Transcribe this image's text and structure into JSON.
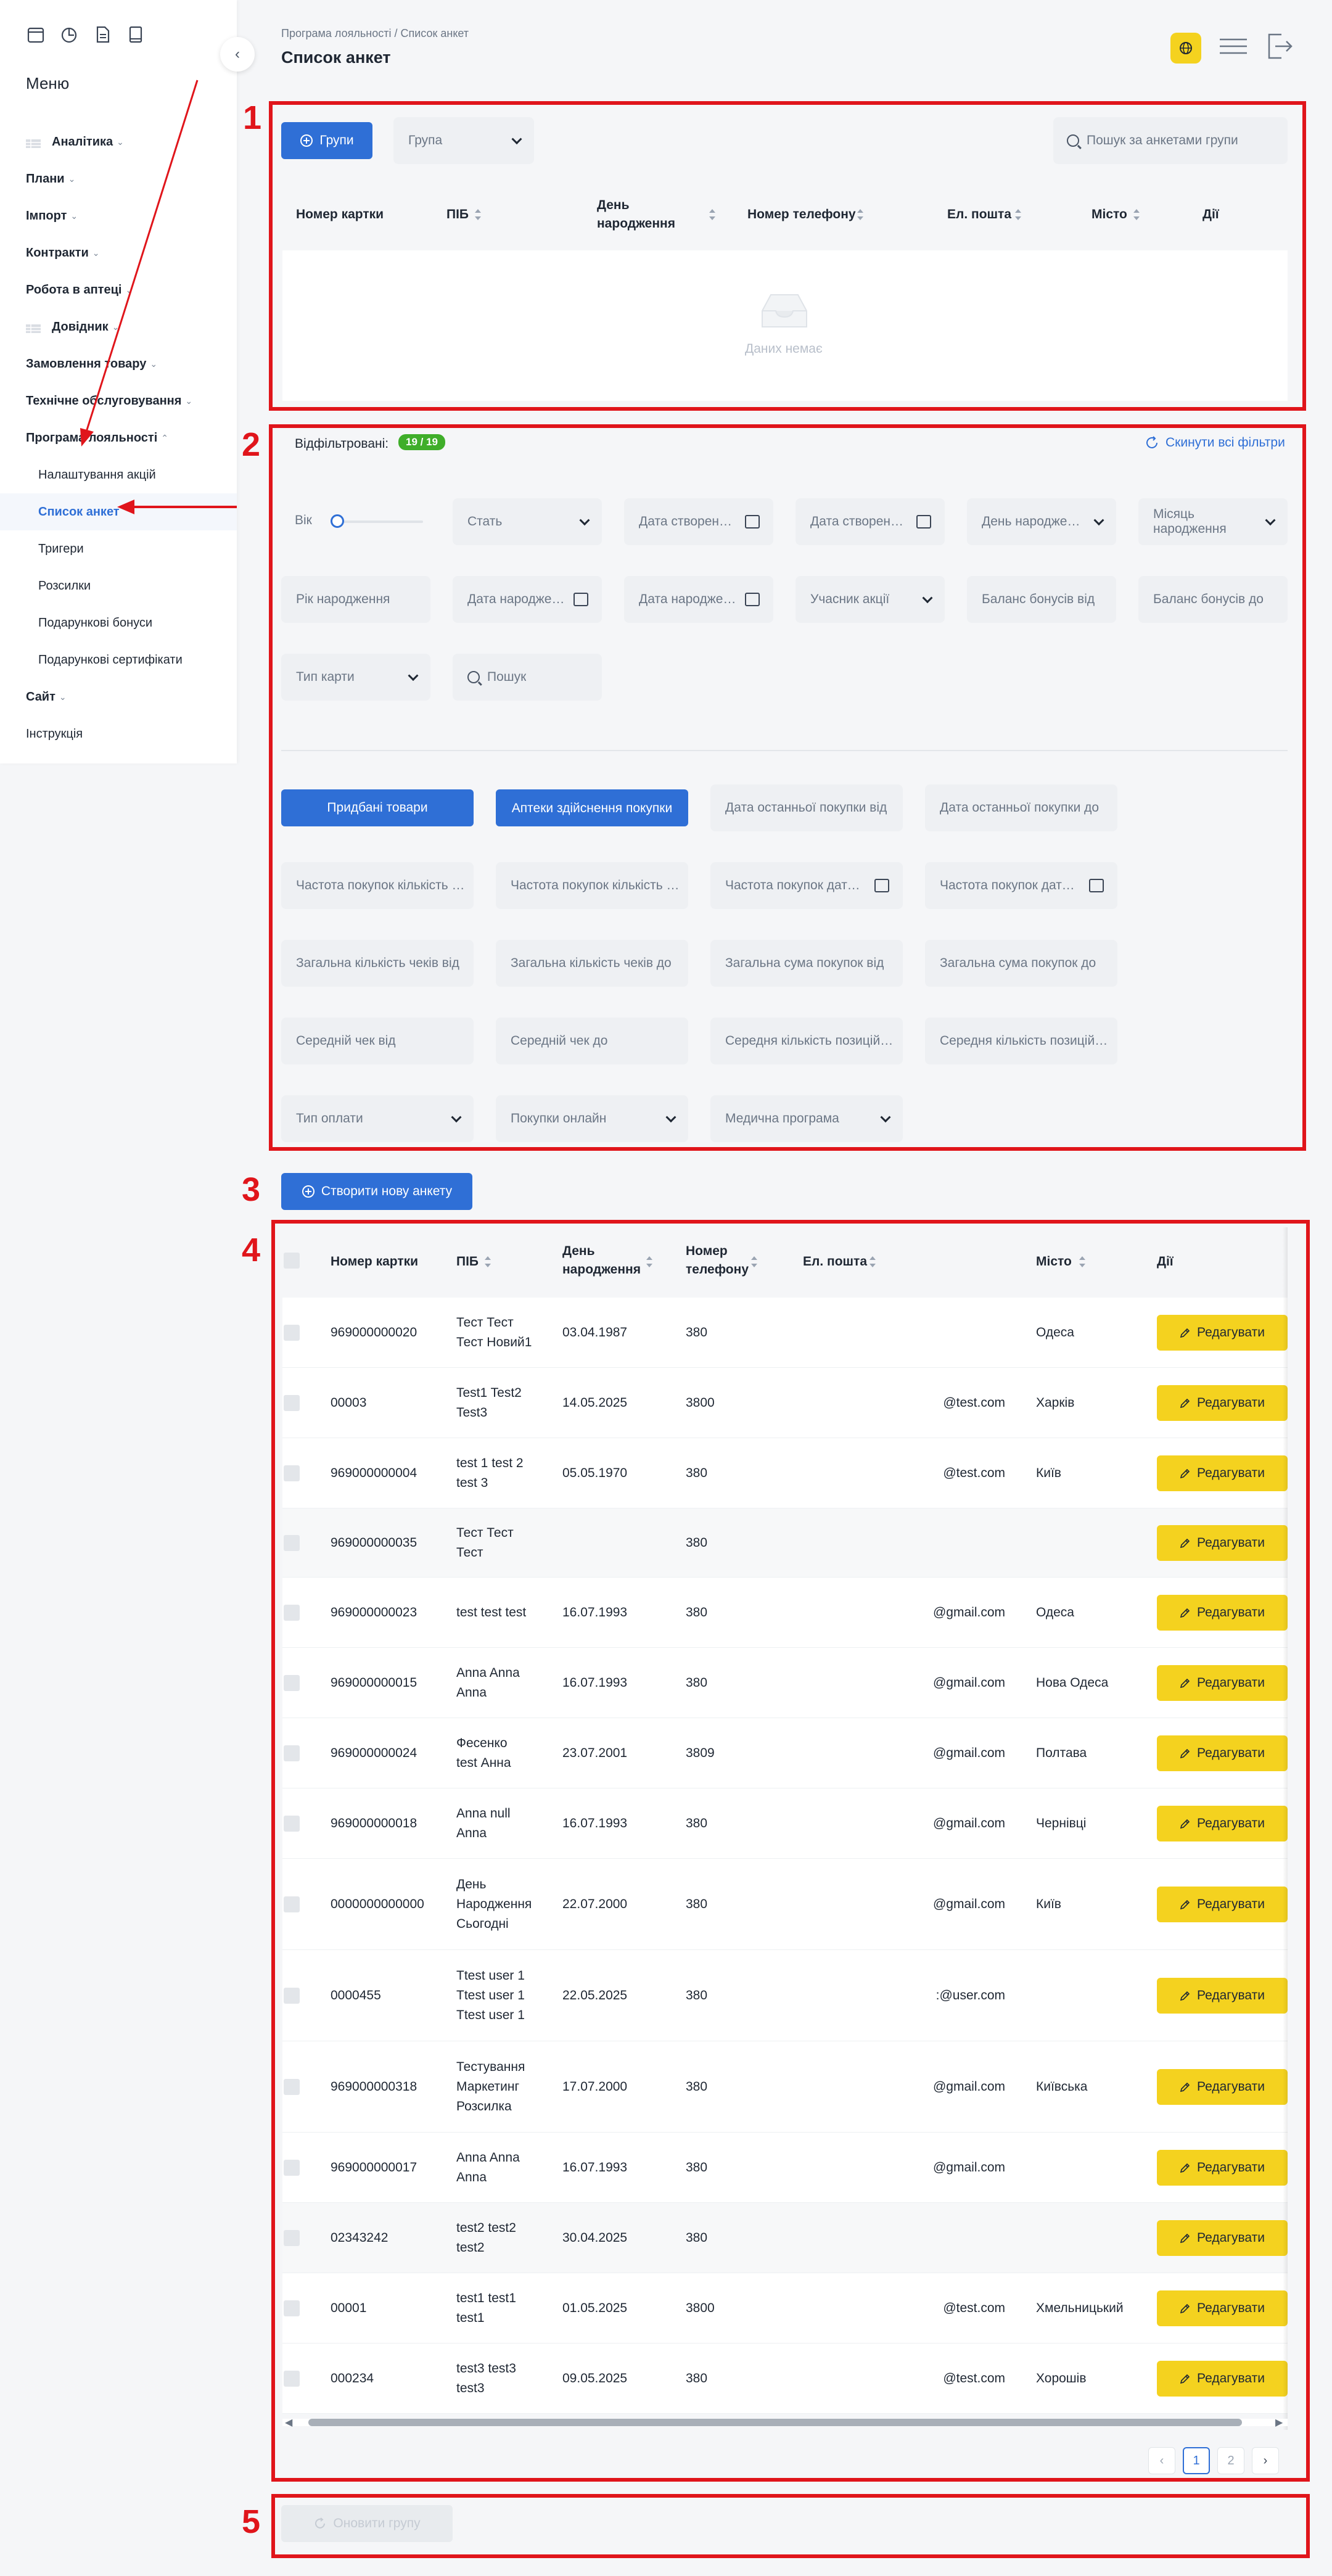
{
  "sidebar": {
    "menu_title": "Меню",
    "items": [
      {
        "label": "Аналітика",
        "chev": "⌄",
        "icon": "table-icon"
      },
      {
        "label": "Плани",
        "chev": "⌄"
      },
      {
        "label": "Імпорт",
        "chev": "⌄"
      },
      {
        "label": "Контракти",
        "chev": "⌄"
      },
      {
        "label": "Робота в аптеці",
        "chev": "⌄"
      },
      {
        "label": "Довідник",
        "chev": "⌄",
        "icon": "table-icon"
      },
      {
        "label": "Замовлення товару",
        "chev": "⌄"
      },
      {
        "label": "Технічне обслуговування",
        "chev": "⌄"
      },
      {
        "label": "Програма лояльності",
        "chev": "⌃"
      }
    ],
    "sub_items": [
      "Налаштування акцій",
      "Список анкет",
      "Тригери",
      "Розсилки",
      "Подарункові бонуси",
      "Подарункові сертифікати"
    ],
    "bottom_items": [
      "Сайт",
      "Інструкція"
    ],
    "bottom_chev": "⌄"
  },
  "header": {
    "breadcrumb": "Програма лояльності / Список анкет",
    "title": "Список анкет"
  },
  "annotations": [
    "1",
    "2",
    "3",
    "4",
    "5"
  ],
  "section1": {
    "groups_button": "Групи",
    "group_select_placeholder": "Група",
    "search_placeholder": "Пошук за анкетами групи",
    "columns": [
      "Номер картки",
      "ПІБ",
      "День народження",
      "Номер телефону",
      "Ел. пошта",
      "Місто",
      "Дії"
    ],
    "empty_text": "Даних немає"
  },
  "section2": {
    "filtered_label": "Відфільтровані:",
    "filtered_badge": "19 / 19",
    "reset_label": "Скинути всі фільтри",
    "age_label": "Вік",
    "fields_row1": [
      "Стать",
      "Дата створення від",
      "Дата створення до",
      "День народження",
      "Місяць народження"
    ],
    "fields_row2": [
      "Рік народження",
      "Дата народження від",
      "Дата народження до",
      "Учасник акції",
      "Баланс бонусів від",
      "Баланс бонусів до"
    ],
    "fields_row3": [
      "Тип карти",
      "Пошук"
    ],
    "buttons": [
      "Придбані товари",
      "Аптеки здійснення покупки"
    ],
    "fields_row4": [
      "Дата останньої покупки від",
      "Дата останньої покупки до"
    ],
    "fields_row5": [
      "Частота покупок кількість від",
      "Частота покупок кількість до",
      "Частота покупок дата від",
      "Частота покупок дата до"
    ],
    "fields_row6": [
      "Загальна кількість чеків від",
      "Загальна кількість чеків до",
      "Загальна сума покупок від",
      "Загальна сума покупок до"
    ],
    "fields_row7": [
      "Середній чек від",
      "Середній чек до",
      "Середня кількість позицій від",
      "Середня кількість позицій до"
    ],
    "fields_row8": [
      "Тип оплати",
      "Покупки онлайн",
      "Медична програма"
    ]
  },
  "section3": {
    "create_button": "Створити нову анкету"
  },
  "section4": {
    "columns": [
      "Номер картки",
      "ПІБ",
      "День народження",
      "Номер телефону",
      "Ел. пошта",
      "Місто",
      "Дії"
    ],
    "edit_label": "Редагувати",
    "rows": [
      {
        "card": "969000000020",
        "name": [
          "Тест Тест",
          "Тест Новий1"
        ],
        "bday": "03.04.1987",
        "phone": "380",
        "email": "",
        "city": "Одеса"
      },
      {
        "card": "00003",
        "name": [
          "Test1 Test2",
          "Test3"
        ],
        "bday": "14.05.2025",
        "phone": "3800",
        "email": "@test.com",
        "city": "Харків"
      },
      {
        "card": "969000000004",
        "name": [
          "test 1 test 2",
          "test 3"
        ],
        "bday": "05.05.1970",
        "phone": "380",
        "email": "@test.com",
        "city": "Київ"
      },
      {
        "card": "969000000035",
        "name": [
          "Тест Тест",
          "Тест"
        ],
        "bday": "",
        "phone": "380",
        "email": "",
        "city": ""
      },
      {
        "card": "969000000023",
        "name": [
          "test test test"
        ],
        "bday": "16.07.1993",
        "phone": "380",
        "email": "@gmail.com",
        "city": "Одеса"
      },
      {
        "card": "969000000015",
        "name": [
          "Anna Anna",
          "Anna"
        ],
        "bday": "16.07.1993",
        "phone": "380",
        "email": "@gmail.com",
        "city": "Нова Одеса"
      },
      {
        "card": "969000000024",
        "name": [
          "Фесенко",
          "test Анна"
        ],
        "bday": "23.07.2001",
        "phone": "3809",
        "email": "@gmail.com",
        "city": "Полтава"
      },
      {
        "card": "969000000018",
        "name": [
          "Anna null",
          "Anna"
        ],
        "bday": "16.07.1993",
        "phone": "380",
        "email": "@gmail.com",
        "city": "Чернівці"
      },
      {
        "card": "0000000000000",
        "name": [
          "День",
          "Народження",
          "Сьогодні"
        ],
        "bday": "22.07.2000",
        "phone": "380",
        "email": "@gmail.com",
        "city": "Київ"
      },
      {
        "card": "0000455",
        "name": [
          "Ttest user 1",
          "Ttest user 1",
          "Ttest user 1"
        ],
        "bday": "22.05.2025",
        "phone": "380",
        "email": ":@user.com",
        "city": ""
      },
      {
        "card": "969000000318",
        "name": [
          "Тестування",
          "Маркетинг",
          "Розсилка"
        ],
        "bday": "17.07.2000",
        "phone": "380",
        "email": "@gmail.com",
        "city": "Київська"
      },
      {
        "card": "969000000017",
        "name": [
          "Anna Anna",
          "Anna"
        ],
        "bday": "16.07.1993",
        "phone": "380",
        "email": "@gmail.com",
        "city": ""
      },
      {
        "card": "02343242",
        "name": [
          "test2 test2",
          "test2"
        ],
        "bday": "30.04.2025",
        "phone": "380",
        "email": "",
        "city": ""
      },
      {
        "card": "00001",
        "name": [
          "test1 test1",
          "test1"
        ],
        "bday": "01.05.2025",
        "phone": "3800",
        "email": "@test.com",
        "city": "Хмельницький"
      },
      {
        "card": "000234",
        "name": [
          "test3 test3",
          "test3"
        ],
        "bday": "09.05.2025",
        "phone": "380",
        "email": "@test.com",
        "city": "Хорошів"
      }
    ],
    "pagination": {
      "prev": "‹",
      "pages": [
        "1",
        "2"
      ],
      "next": "›",
      "active": "1"
    }
  },
  "section5": {
    "update_button": "Оновити групу"
  }
}
